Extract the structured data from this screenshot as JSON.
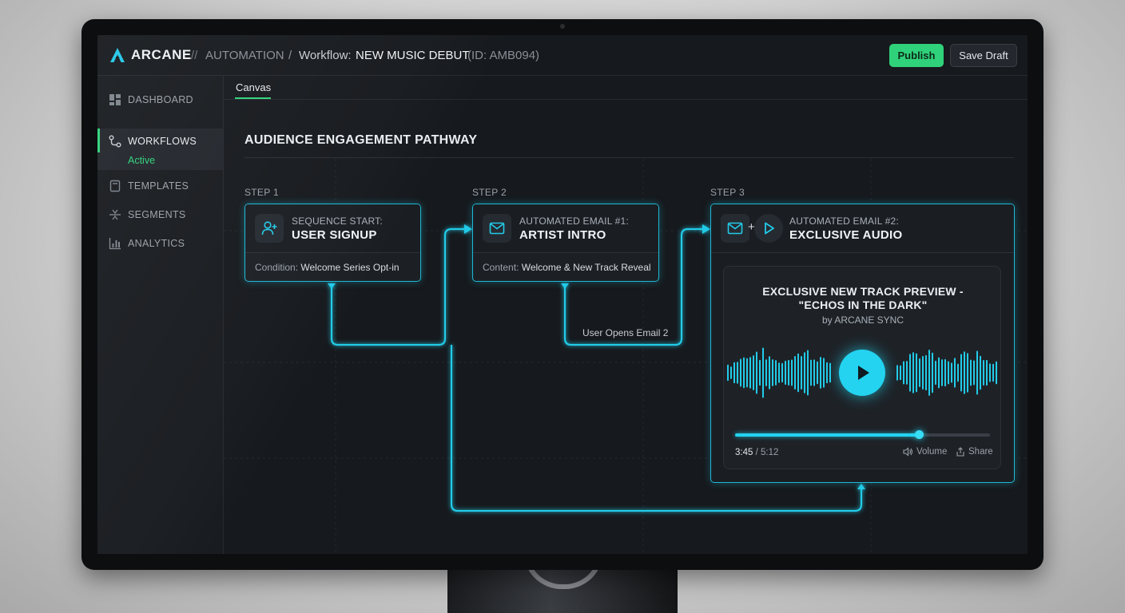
{
  "app": {
    "brand": "ARCANE",
    "breadcrumb": {
      "sep1": "//",
      "section": "AUTOMATION",
      "sep2": "/",
      "workflow_prefix": "Workflow:",
      "workflow_name": "NEW MUSIC DEBUT",
      "workflow_id": "(ID: AMB094)"
    },
    "publish_label": "Publish",
    "save_draft_label": "Save Draft"
  },
  "sidebar": {
    "items": [
      {
        "label": "DASHBOARD",
        "icon": "dashboard-icon"
      },
      {
        "label": "WORKFLOWS",
        "icon": "workflow-icon",
        "sub": "Active",
        "active": true
      },
      {
        "label": "TEMPLATES",
        "icon": "template-icon"
      },
      {
        "label": "SEGMENTS",
        "icon": "segments-icon"
      },
      {
        "label": "ANALYTICS",
        "icon": "analytics-icon"
      }
    ]
  },
  "tabs": [
    {
      "label": "Canvas",
      "active": true
    }
  ],
  "canvas": {
    "title": "AUDIENCE ENGAGEMENT PATHWAY",
    "steps": [
      {
        "step_label": "STEP 1",
        "kicker": "SEQUENCE START:",
        "title": "USER SIGNUP",
        "foot_key": "Condition:",
        "foot_value": "Welcome Series Opt-in",
        "icon": "user-add-icon"
      },
      {
        "step_label": "STEP 2",
        "kicker": "AUTOMATED EMAIL #1:",
        "title": "ARTIST INTRO",
        "foot_key": "Content:",
        "foot_value": "Welcome & New Track Reveal",
        "icon": "mail-icon"
      },
      {
        "step_label": "STEP 3",
        "kicker": "AUTOMATED EMAIL #2:",
        "title": "EXCLUSIVE AUDIO",
        "icon": "mail-icon",
        "plus": "+"
      }
    ],
    "connector_label": "User Opens Email 2",
    "player": {
      "title_line1": "EXCLUSIVE NEW TRACK PREVIEW -",
      "title_line2": "\"ECHOS IN THE DARK\"",
      "by": "by ARCANE SYNC",
      "current_time": "3:45",
      "duration": "/ 5:12",
      "progress": 0.72,
      "volume_label": "Volume",
      "share_label": "Share"
    }
  },
  "colors": {
    "accent_green": "#2fd27a",
    "accent_cyan": "#23d3f0",
    "card_border": "#1fb8d6"
  }
}
